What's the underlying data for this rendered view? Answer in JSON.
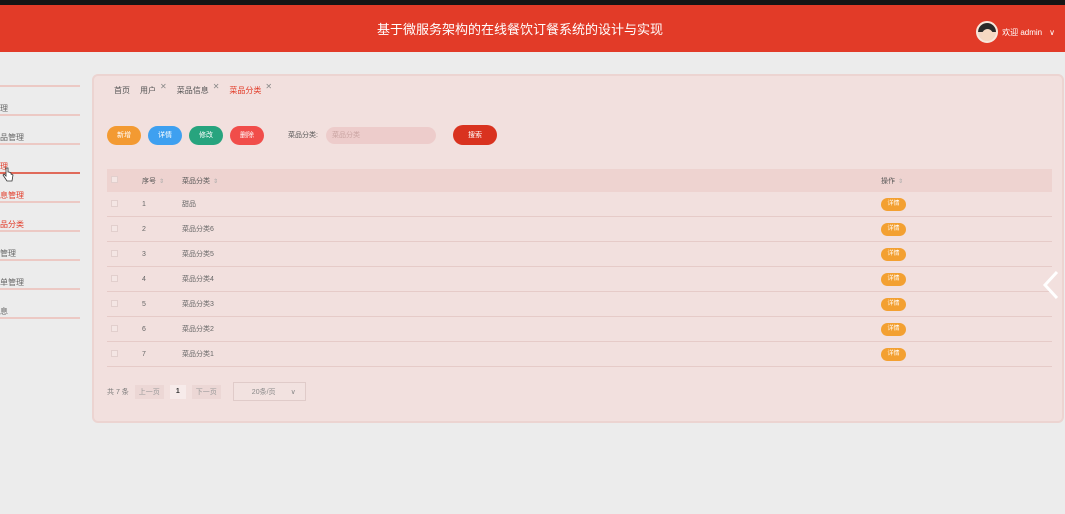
{
  "header": {
    "title": "基于微服务架构的在线餐饮订餐系统的设计与实现",
    "user_label": "欢迎 admin",
    "chevron": "∨"
  },
  "sidebar": {
    "items": [
      {
        "label": "理"
      },
      {
        "label": "品管理"
      },
      {
        "label": "理"
      },
      {
        "label": "息管理"
      },
      {
        "label": "品分类"
      },
      {
        "label": "管理"
      },
      {
        "label": "单管理"
      },
      {
        "label": "息"
      }
    ]
  },
  "tabs": [
    {
      "label": "首页"
    },
    {
      "label": "用户",
      "close": "✕"
    },
    {
      "label": "菜品信息",
      "close": "✕"
    },
    {
      "label": "菜品分类",
      "close": "✕"
    }
  ],
  "toolbar": {
    "add": "新增",
    "detail": "详情",
    "edit": "修改",
    "delete": "删除",
    "search_label": "菜品分类:",
    "search_placeholder": "菜品分类",
    "search_button": "搜索"
  },
  "table": {
    "headers": {
      "index": "序号",
      "name": "菜品分类",
      "op": "操作",
      "sort": "⇕"
    },
    "rows": [
      {
        "index": "1",
        "name": "甜品",
        "action": "详情"
      },
      {
        "index": "2",
        "name": "菜品分类6",
        "action": "详情"
      },
      {
        "index": "3",
        "name": "菜品分类5",
        "action": "详情"
      },
      {
        "index": "4",
        "name": "菜品分类4",
        "action": "详情"
      },
      {
        "index": "5",
        "name": "菜品分类3",
        "action": "详情"
      },
      {
        "index": "6",
        "name": "菜品分类2",
        "action": "详情"
      },
      {
        "index": "7",
        "name": "菜品分类1",
        "action": "详情"
      }
    ]
  },
  "pagination": {
    "total": "共 7 条",
    "prev": "上一页",
    "page": "1",
    "next": "下一页",
    "page_size": "20条/页",
    "chevron": "∨"
  },
  "colors": {
    "brand": "#e23b28",
    "add": "#f39a32",
    "detail": "#3ea0f0",
    "edit": "#27a47e",
    "delete": "#f14d4a"
  },
  "icons": {
    "right_nav": "chevron-left-icon",
    "cursor": "hand-pointer-icon"
  }
}
